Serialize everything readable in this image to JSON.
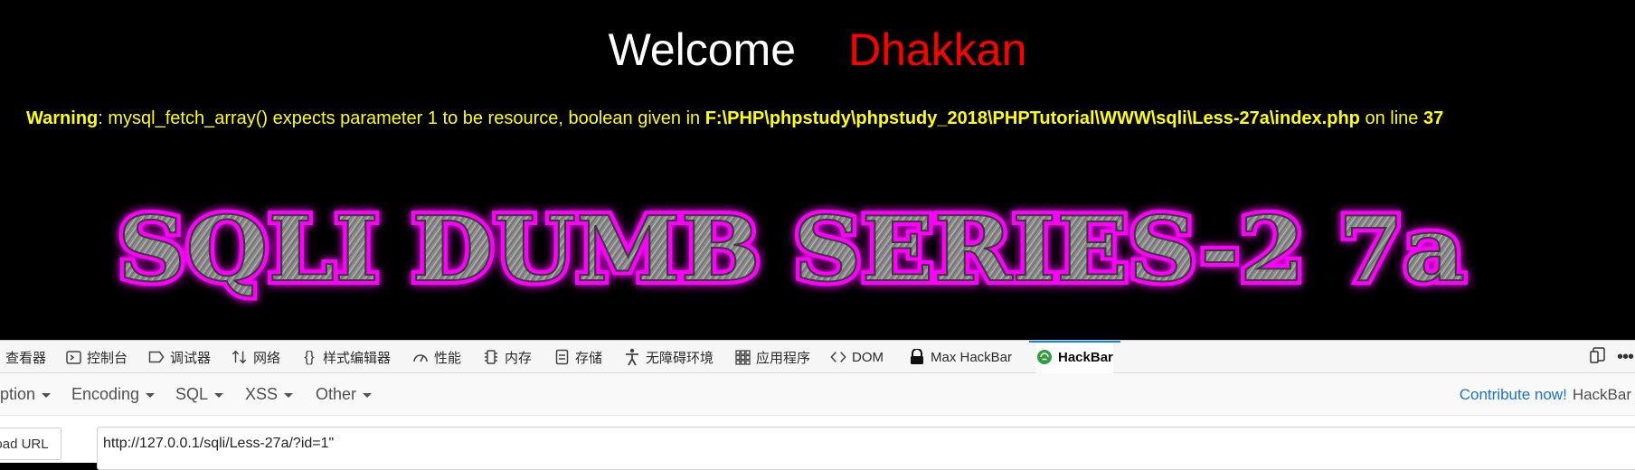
{
  "page": {
    "welcome": "Welcome",
    "name": "Dhakkan",
    "warning": {
      "label": "Warning",
      "message": ": mysql_fetch_array() expects parameter 1 to be resource, boolean given in ",
      "path": "F:\\PHP\\phpstudy\\phpstudy_2018\\PHPTutorial\\WWW\\sqli\\Less-27a\\index.php",
      "on_line": " on line ",
      "line": "37"
    },
    "banner_text": "SQLI DUMB SERIES-2 7a"
  },
  "devtools": {
    "tabs": [
      {
        "label": "查看器",
        "icon": "inspector-icon"
      },
      {
        "label": "控制台",
        "icon": "console-icon"
      },
      {
        "label": "调试器",
        "icon": "debugger-icon"
      },
      {
        "label": "网络",
        "icon": "network-icon"
      },
      {
        "label": "样式编辑器",
        "icon": "style-editor-icon"
      },
      {
        "label": "性能",
        "icon": "performance-icon"
      },
      {
        "label": "内存",
        "icon": "memory-icon"
      },
      {
        "label": "存储",
        "icon": "storage-icon"
      },
      {
        "label": "无障碍环境",
        "icon": "accessibility-icon"
      },
      {
        "label": "应用程序",
        "icon": "application-icon"
      },
      {
        "label": "DOM",
        "icon": "dom-icon"
      },
      {
        "label": "Max HackBar",
        "icon": "max-hackbar-icon"
      },
      {
        "label": "HackBar",
        "icon": "hackbar-icon",
        "active": true
      }
    ]
  },
  "hackbar": {
    "menus": [
      "ption",
      "Encoding",
      "SQL",
      "XSS",
      "Other"
    ],
    "contribute": "Contribute now!",
    "brand": "HackBar",
    "load_url": "oad URL",
    "url": "http://127.0.0.1/sqli/Less-27a/?id=1\""
  },
  "colors": {
    "accent": "#0a84ff",
    "warning": "#ffff00",
    "name": "#ff0000",
    "banner_stroke": "#ff00ff",
    "link": "#1a73c9"
  }
}
